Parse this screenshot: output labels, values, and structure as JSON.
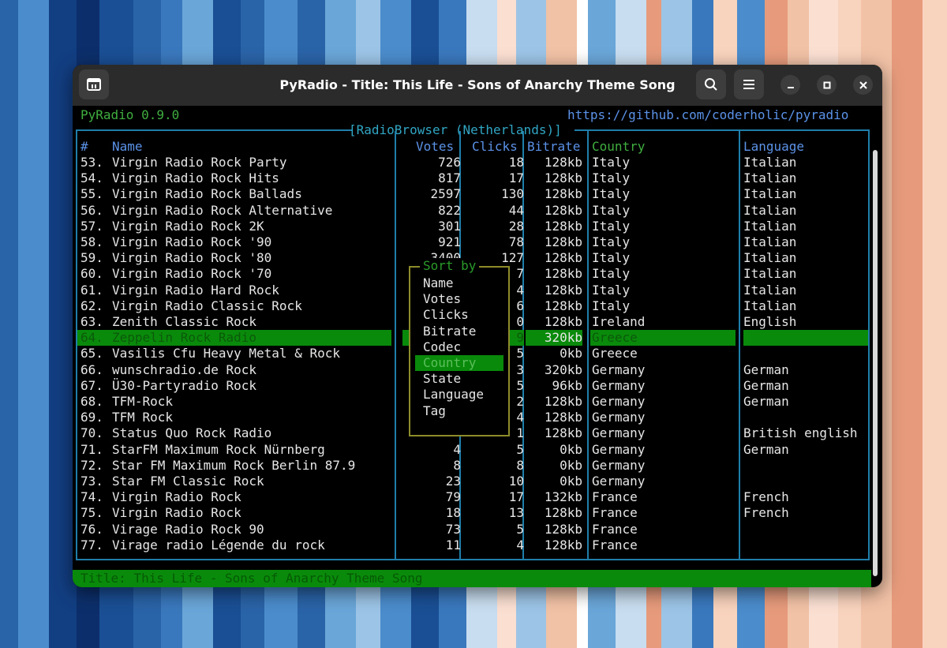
{
  "background_stripes": [
    "#2a64a8",
    "#4b8ccc",
    "#123e82",
    "#0c2f6b",
    "#1a4f95",
    "#2a64a8",
    "#3a78bd",
    "#6aa6d8",
    "#1a4f95",
    "#2a64a8",
    "#4b8ccc",
    "#2a64a8",
    "#6aa6d8",
    "#9cc4e6",
    "#4b8ccc",
    "#1a4f95",
    "#3a78bd",
    "#c8def0",
    "#fbe0d2",
    "#9cc4e6",
    "#f2c2a6",
    "#ffffff",
    "#6aa6d8",
    "#c8def0",
    "#e79b7c",
    "#9cc4e6",
    "#3a78bd",
    "#f8d3bd",
    "#4b8ccc",
    "#e79b7c",
    "#f2c2a6",
    "#fbe0d2",
    "#f8d3bd",
    "#f2c2a6",
    "#e79b7c",
    "#f8d3bd"
  ],
  "window": {
    "title": "PyRadio - Title: This Life - Sons of Anarchy Theme Song",
    "icons": {
      "app": "terminal-tab-icon",
      "search": "search-icon",
      "menu": "hamburger-menu-icon",
      "minimize": "minimize-icon",
      "maximize": "maximize-icon",
      "close": "close-icon"
    }
  },
  "terminal": {
    "app_version": "PyRadio 0.9.0",
    "url": "https://github.com/coderholic/pyradio",
    "panel_title": "[RadioBrowser (Netherlands)]",
    "columns": {
      "num": "#",
      "name": "Name",
      "votes": "Votes",
      "clicks": "Clicks",
      "bitrate": "Bitrate",
      "country": "Country",
      "language": "Language"
    },
    "rows": [
      {
        "num": "53.",
        "name": "Virgin Radio Rock Party",
        "votes": "726",
        "clicks": "18",
        "bitrate": "128kb",
        "country": "Italy",
        "language": "Italian"
      },
      {
        "num": "54.",
        "name": "Virgin Radio Rock Hits",
        "votes": "817",
        "clicks": "17",
        "bitrate": "128kb",
        "country": "Italy",
        "language": "Italian"
      },
      {
        "num": "55.",
        "name": "Virgin Radio Rock Ballads",
        "votes": "2597",
        "clicks": "130",
        "bitrate": "128kb",
        "country": "Italy",
        "language": "Italian"
      },
      {
        "num": "56.",
        "name": "Virgin Radio Rock Alternative",
        "votes": "822",
        "clicks": "44",
        "bitrate": "128kb",
        "country": "Italy",
        "language": "Italian"
      },
      {
        "num": "57.",
        "name": "Virgin Radio Rock 2K",
        "votes": "301",
        "clicks": "28",
        "bitrate": "128kb",
        "country": "Italy",
        "language": "Italian"
      },
      {
        "num": "58.",
        "name": "Virgin Radio Rock '90",
        "votes": "921",
        "clicks": "78",
        "bitrate": "128kb",
        "country": "Italy",
        "language": "Italian"
      },
      {
        "num": "59.",
        "name": "Virgin Radio Rock '80",
        "votes": "3400",
        "clicks": "127",
        "bitrate": "128kb",
        "country": "Italy",
        "language": "Italian"
      },
      {
        "num": "60.",
        "name": "Virgin Radio Rock '70",
        "votes": "",
        "clicks": "7",
        "bitrate": "128kb",
        "country": "Italy",
        "language": "Italian"
      },
      {
        "num": "61.",
        "name": "Virgin Radio Hard Rock",
        "votes": "",
        "clicks": "4",
        "bitrate": "128kb",
        "country": "Italy",
        "language": "Italian"
      },
      {
        "num": "62.",
        "name": "Virgin Radio Classic Rock",
        "votes": "",
        "clicks": "6",
        "bitrate": "128kb",
        "country": "Italy",
        "language": "Italian"
      },
      {
        "num": "63.",
        "name": "Zenith Classic Rock",
        "votes": "",
        "clicks": "0",
        "bitrate": "128kb",
        "country": "Ireland",
        "language": "English"
      },
      {
        "num": "64.",
        "name": "Zeppelin Rock Radio",
        "votes": "",
        "clicks": "9",
        "bitrate": "320kb",
        "country": "Greece",
        "language": ""
      },
      {
        "num": "65.",
        "name": "Vasilis Cfu Heavy Metal & Rock",
        "votes": "",
        "clicks": "5",
        "bitrate": "0kb",
        "country": "Greece",
        "language": ""
      },
      {
        "num": "66.",
        "name": "wunschradio.de Rock",
        "votes": "",
        "clicks": "3",
        "bitrate": "320kb",
        "country": "Germany",
        "language": "German"
      },
      {
        "num": "67.",
        "name": "Ü30-Partyradio Rock",
        "votes": "",
        "clicks": "5",
        "bitrate": "96kb",
        "country": "Germany",
        "language": "German"
      },
      {
        "num": "68.",
        "name": "TFM-Rock",
        "votes": "",
        "clicks": "2",
        "bitrate": "128kb",
        "country": "Germany",
        "language": "German"
      },
      {
        "num": "69.",
        "name": "TFM Rock",
        "votes": "",
        "clicks": "4",
        "bitrate": "128kb",
        "country": "Germany",
        "language": ""
      },
      {
        "num": "70.",
        "name": "Status Quo Rock Radio",
        "votes": "",
        "clicks": "1",
        "bitrate": "128kb",
        "country": "Germany",
        "language": "British english"
      },
      {
        "num": "71.",
        "name": "StarFM Maximum Rock Nürnberg",
        "votes": "4",
        "clicks": "5",
        "bitrate": "0kb",
        "country": "Germany",
        "language": "German"
      },
      {
        "num": "72.",
        "name": "Star FM Maximum Rock Berlin 87.9",
        "votes": "8",
        "clicks": "8",
        "bitrate": "0kb",
        "country": "Germany",
        "language": ""
      },
      {
        "num": "73.",
        "name": "Star FM Classic Rock",
        "votes": "23",
        "clicks": "10",
        "bitrate": "0kb",
        "country": "Germany",
        "language": ""
      },
      {
        "num": "74.",
        "name": "Virgin Radio Rock",
        "votes": "79",
        "clicks": "17",
        "bitrate": "132kb",
        "country": "France",
        "language": "French"
      },
      {
        "num": "75.",
        "name": "Virgin Radio Rock",
        "votes": "18",
        "clicks": "13",
        "bitrate": "128kb",
        "country": "France",
        "language": "French"
      },
      {
        "num": "76.",
        "name": "Virage Radio Rock 90",
        "votes": "73",
        "clicks": "5",
        "bitrate": "128kb",
        "country": "France",
        "language": ""
      },
      {
        "num": "77.",
        "name": "Virage radio Légende du rock",
        "votes": "11",
        "clicks": "4",
        "bitrate": "128kb",
        "country": "France",
        "language": ""
      }
    ],
    "selected_row": "64.",
    "sort_menu": {
      "title": "Sort by",
      "options": [
        "Name",
        "Votes",
        "Clicks",
        "Bitrate",
        "Codec",
        "Country",
        "State",
        "Language",
        "Tag"
      ],
      "active": "Country"
    },
    "status_bar": "Title: This Life - Sons of Anarchy Theme Song"
  }
}
